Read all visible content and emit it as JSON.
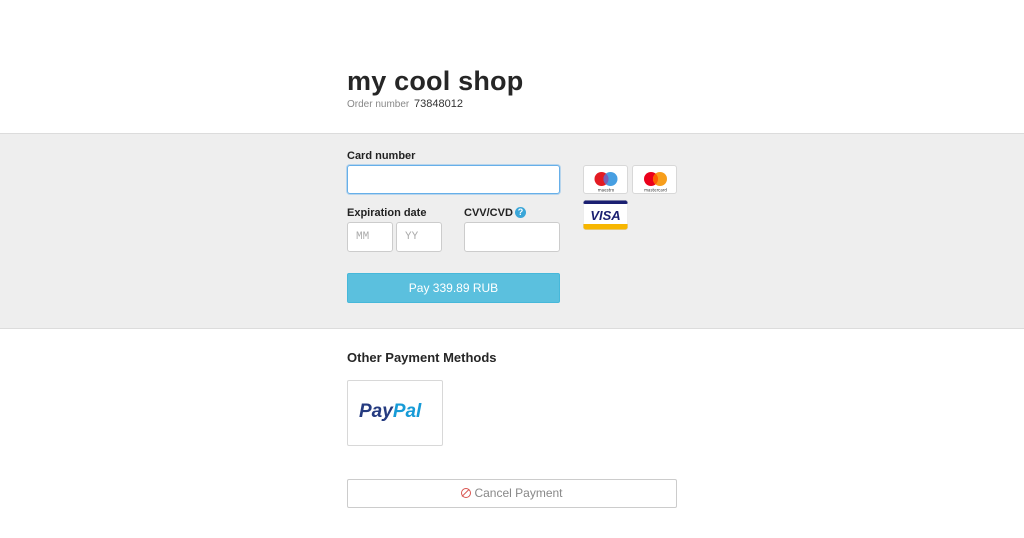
{
  "shop": {
    "title": "my cool shop",
    "order_label": "Order number",
    "order_number": "73848012"
  },
  "card_form": {
    "card_number_label": "Card number",
    "card_number_value": "",
    "expiration_label": "Expiration date",
    "month_placeholder": "MM",
    "year_placeholder": "YY",
    "cvv_label": "CVV/CVD",
    "cvv_value": "",
    "help_icon": "?",
    "pay_button_label": "Pay 339.89 RUB"
  },
  "card_brands": [
    {
      "name": "maestro",
      "icon": "maestro-logo-icon"
    },
    {
      "name": "mastercard",
      "icon": "mastercard-logo-icon"
    },
    {
      "name": "VISA",
      "icon": "visa-logo-icon"
    }
  ],
  "other_methods": {
    "title": "Other Payment Methods",
    "paypal_part1": "Pay",
    "paypal_part2": "Pal"
  },
  "cancel": {
    "label": "Cancel Payment",
    "icon": "ban-icon"
  },
  "colors": {
    "pay_button": "#5bc0de",
    "panel_background": "#eeeeee",
    "cancel_icon": "#d9534f",
    "paypal_dark": "#253b80",
    "paypal_light": "#179bd7"
  }
}
